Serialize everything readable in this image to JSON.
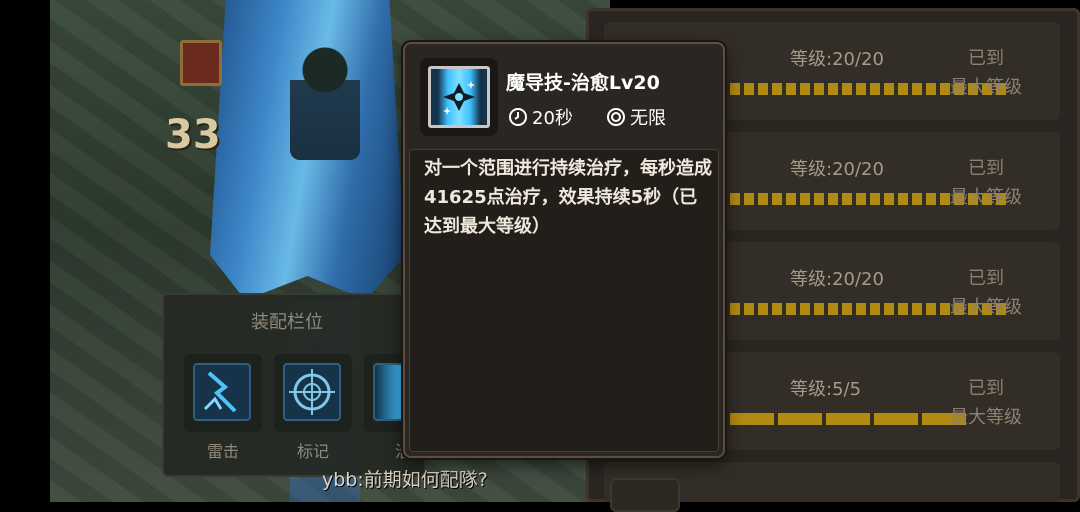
{
  "scene": {
    "score": "33",
    "chat_line": "ybb:前期如何配隊?"
  },
  "equip_panel": {
    "title": "装配栏位",
    "slots": [
      {
        "label": "雷击",
        "icon": "lightning-icon"
      },
      {
        "label": "标记",
        "icon": "crosshair-icon"
      },
      {
        "label": "治",
        "icon": "heal-crystal-icon"
      }
    ]
  },
  "tooltip": {
    "title": "魔导技-治愈Lv20",
    "cooldown": "20秒",
    "range": "无限",
    "description": "对一个范围进行持续治疗，每秒造成41625点治疗，效果持续5秒（已达到最大等级）",
    "icons": {
      "skill": "heal-crystal-icon",
      "cooldown": "clock-icon",
      "range": "target-ring-icon"
    }
  },
  "skill_rows": [
    {
      "level_text": "等级:20/20",
      "max_line1": "已到",
      "max_line2": "最大等级",
      "level": 20,
      "max": 20
    },
    {
      "level_text": "等级:20/20",
      "max_line1": "已到",
      "max_line2": "最大等级",
      "level": 20,
      "max": 20
    },
    {
      "level_text": "等级:20/20",
      "max_line1": "已到",
      "max_line2": "最大等级",
      "level": 20,
      "max": 20
    },
    {
      "level_text": "等级:5/5",
      "max_line1": "已到",
      "max_line2": "最大等级",
      "level": 5,
      "max": 5
    }
  ],
  "colors": {
    "pip": "#b08a12",
    "panel": "#2a2520",
    "tooltip_border": "#5c4d3e"
  }
}
